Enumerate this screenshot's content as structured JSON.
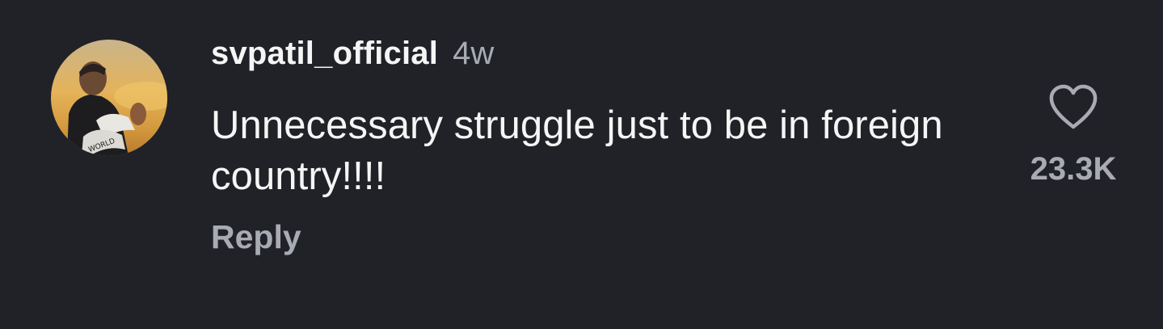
{
  "comment": {
    "username": "svpatil_official",
    "time": "4w",
    "text": "Unnecessary struggle just to be in foreign country!!!!",
    "reply_label": "Reply",
    "like_count": "23.3K",
    "avatar_icon": "user-avatar",
    "like_icon": "heart-outline-icon"
  },
  "colors": {
    "background": "#212227",
    "primary_text": "#f5f5f5",
    "secondary_text": "#a8abb3"
  }
}
